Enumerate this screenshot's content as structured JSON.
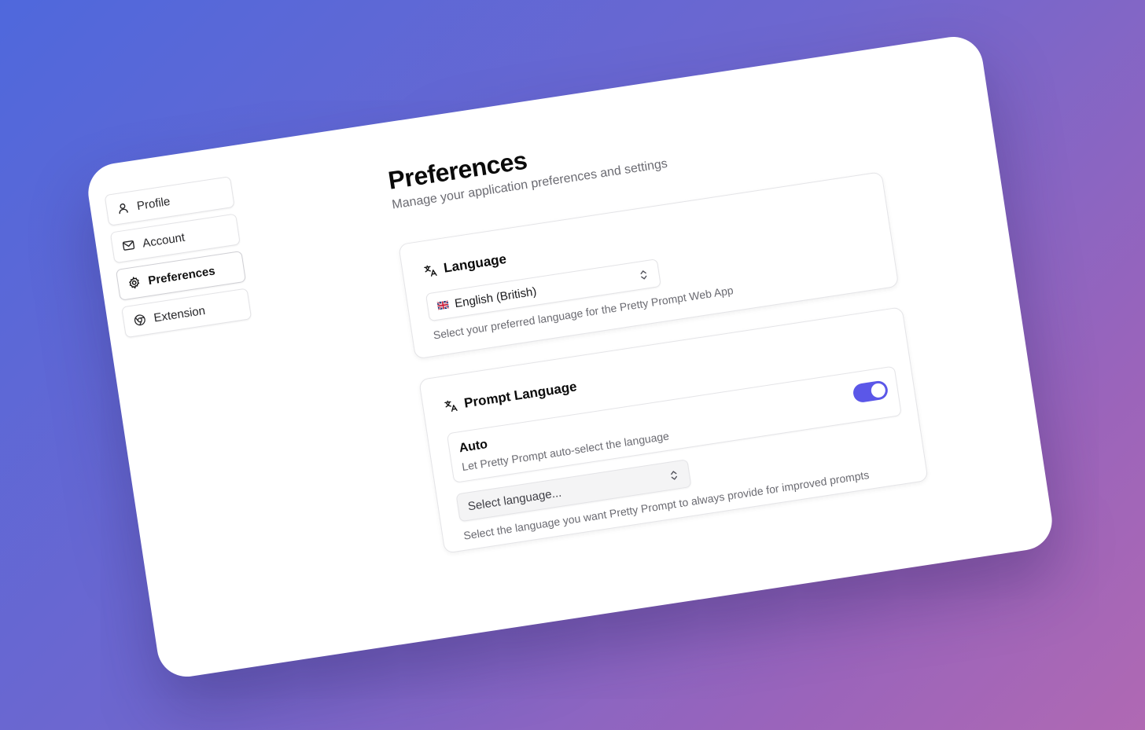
{
  "sidebar": {
    "items": [
      {
        "label": "Profile",
        "icon": "user-icon"
      },
      {
        "label": "Account",
        "icon": "mail-icon"
      },
      {
        "label": "Preferences",
        "icon": "gear-icon",
        "active": true
      },
      {
        "label": "Extension",
        "icon": "chrome-icon"
      }
    ]
  },
  "header": {
    "title": "Preferences",
    "subtitle": "Manage your application preferences and settings"
  },
  "language": {
    "title": "Language",
    "icon": "translate-icon",
    "selected": "English (British)",
    "flag": "uk-flag-icon",
    "helper": "Select your preferred language for the Pretty Prompt Web App"
  },
  "prompt_language": {
    "title": "Prompt Language",
    "icon": "translate-icon",
    "auto_title": "Auto",
    "auto_desc": "Let Pretty Prompt auto-select the language",
    "auto_enabled": true,
    "select_placeholder": "Select language...",
    "helper": "Select the language you want Pretty Prompt to always provide for improved prompts"
  },
  "colors": {
    "accent": "#5b57e8",
    "background_start": "#4f68dc",
    "background_end": "#b069b3"
  }
}
